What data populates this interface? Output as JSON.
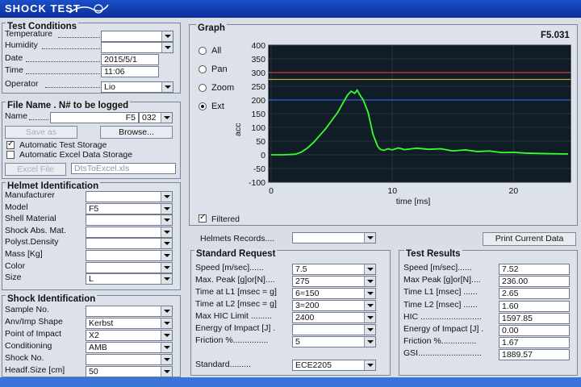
{
  "window": {
    "title": "SHOCK TEST"
  },
  "test_conditions": {
    "title": "Test Conditions",
    "temperature_label": "Temperature",
    "temperature_value": "",
    "humidity_label": "Humidity",
    "humidity_value": "",
    "date_label": "Date",
    "date_value": "2015/5/1",
    "time_label": "Time",
    "time_value": "11:06",
    "operator_label": "Operator",
    "operator_value": "Lio"
  },
  "file_name": {
    "title": "File Name . N# to be logged",
    "name_label": "Name",
    "name_value": "F5",
    "number_value": "032",
    "save_as": "Save as",
    "browse": "Browse...",
    "auto_test_storage": "Automatic Test Storage",
    "auto_excel_storage": "Automatic Excel Data Storage",
    "excel_file": "Excel File",
    "excel_value": "DtsToExcel.xls"
  },
  "helmet": {
    "title": "Helmet Identification",
    "fields": [
      {
        "label": "Manufacturer",
        "value": ""
      },
      {
        "label": "Model",
        "value": "F5"
      },
      {
        "label": "Shell Material",
        "value": ""
      },
      {
        "label": "Shock Abs. Mat.",
        "value": ""
      },
      {
        "label": "Polyst.Density",
        "value": ""
      },
      {
        "label": "Mass [Kg]",
        "value": ""
      },
      {
        "label": "Color",
        "value": ""
      },
      {
        "label": "Size",
        "value": "L"
      }
    ]
  },
  "shock": {
    "title": "Shock Identification",
    "fields": [
      {
        "label": "Sample No.",
        "value": ""
      },
      {
        "label": "Anv/Imp Shape",
        "value": "Kerbst"
      },
      {
        "label": "Point of Impact",
        "value": "X2"
      },
      {
        "label": "Conditioning",
        "value": "AMB"
      },
      {
        "label": "Shock No.",
        "value": ""
      },
      {
        "label": "Headf.Size [cm]",
        "value": "50"
      }
    ]
  },
  "graph": {
    "title": "Graph",
    "tag": "F5.031",
    "modes": [
      "All",
      "Pan",
      "Zoom",
      "Ext"
    ],
    "selected_mode": "Ext",
    "filtered_label": "Filtered",
    "x_axis_label": "time [ms]",
    "y_axis_label": "acc",
    "y_ticks": [
      "400",
      "350",
      "300",
      "250",
      "200",
      "150",
      "100",
      "50",
      "0",
      "-50",
      "-100"
    ],
    "x_ticks": [
      "0",
      "10",
      "20"
    ]
  },
  "chart_data": {
    "type": "line",
    "xlabel": "time [ms]",
    "ylabel": "acc",
    "xlim": [
      -0.2,
      24.7
    ],
    "ylim": [
      -100,
      400
    ],
    "series": [
      {
        "name": "",
        "color": "#36ff2e",
        "x": [
          0,
          1,
          2,
          2.5,
          3,
          3.5,
          4,
          4.5,
          5,
          5.5,
          6,
          6.3,
          6.6,
          6.9,
          7.1,
          7.3,
          7.6,
          8,
          8.4,
          8.8,
          9,
          9.3,
          9.6,
          10,
          10.5,
          11,
          12,
          13,
          14,
          15,
          16,
          17,
          18,
          19,
          20,
          21,
          22,
          23,
          24.5
        ],
        "y": [
          0,
          0,
          2,
          10,
          25,
          45,
          70,
          95,
          125,
          155,
          195,
          218,
          232,
          224,
          236,
          220,
          200,
          155,
          75,
          30,
          20,
          16,
          22,
          18,
          25,
          19,
          24,
          20,
          22,
          14,
          18,
          12,
          14,
          8,
          9,
          6,
          5,
          4,
          3
        ]
      }
    ],
    "reference_lines": [
      {
        "y": 300,
        "color": "#d23a32"
      },
      {
        "y": 275,
        "color": "#c9a23a"
      },
      {
        "y": 200,
        "color": "#2f5ce0"
      }
    ]
  },
  "helmets_records": {
    "label": "Helmets Records....",
    "value": ""
  },
  "print_button": "Print Current Data",
  "standard_request": {
    "title": "Standard Request",
    "fields": [
      {
        "label": "Speed [m/sec]......",
        "value": "7.5"
      },
      {
        "label": "Max. Peak [g]or[N]....",
        "value": "275"
      },
      {
        "label": "Time at L1 [msec = g]",
        "value": "6=150"
      },
      {
        "label": "Time at L2 [msec = g]",
        "value": "3=200"
      },
      {
        "label": "Max  HIC Limit .........",
        "value": "2400"
      },
      {
        "label": "Energy of Impact [J]  .",
        "value": ""
      },
      {
        "label": "  Friction %...............",
        "value": "5"
      }
    ],
    "standard_label": "Standard.........",
    "standard_value": "ECE2205"
  },
  "test_results": {
    "title": "Test Results",
    "fields": [
      {
        "label": "Speed [m/sec]......",
        "value": "7.52"
      },
      {
        "label": "Max Peak [g]or[N]....",
        "value": "236.00"
      },
      {
        "label": "Time L1 [msec] ......",
        "value": "2.65"
      },
      {
        "label": "Time L2 [msec] ......",
        "value": "1.60"
      },
      {
        "label": "HIC ..........................",
        "value": "1597.85"
      },
      {
        "label": "Energy of Impact [J] .",
        "value": "0.00"
      },
      {
        "label": "Friction %...............",
        "value": "1.67"
      },
      {
        "label": "GSI...........................",
        "value": "1889.57"
      }
    ]
  }
}
